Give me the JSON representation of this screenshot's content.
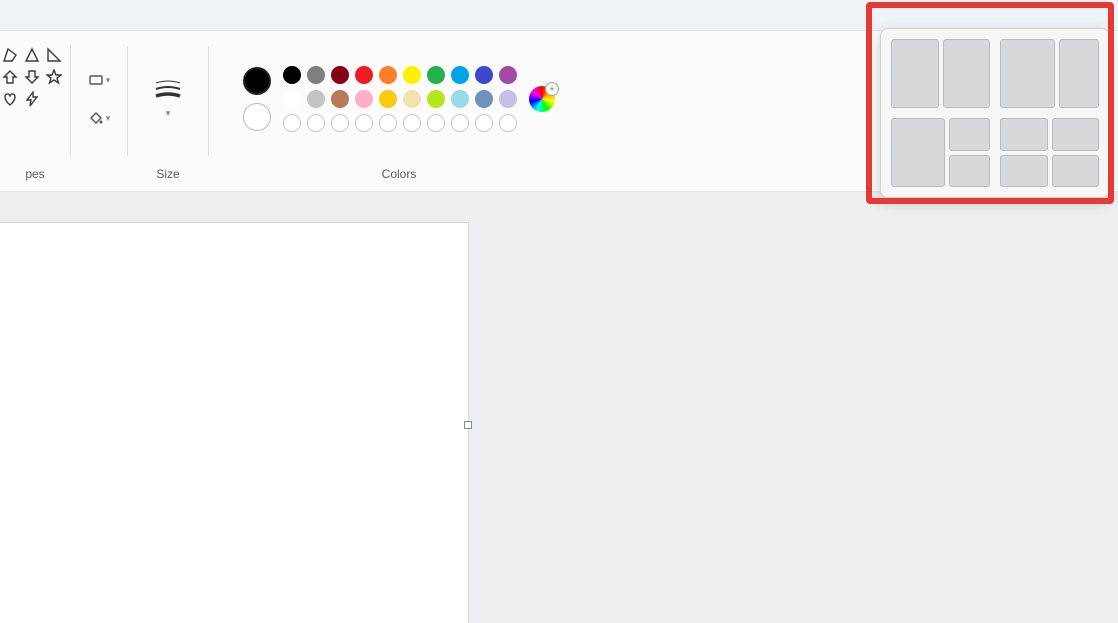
{
  "ribbon": {
    "shapes_label": "pes",
    "size_label": "Size",
    "colors_label": "Colors"
  },
  "colors": {
    "primary": "#000000",
    "secondary": "#ffffff",
    "row1": [
      "#000000",
      "#7f7f7f",
      "#880015",
      "#ed1c24",
      "#ff7f27",
      "#fff200",
      "#22b14c",
      "#00a2e8",
      "#3f48cc",
      "#a349a4"
    ],
    "row2": [
      "#ffffff",
      "#c3c3c3",
      "#b97a57",
      "#ffaec9",
      "#ffc90e",
      "#efe4b0",
      "#b5e61d",
      "#99d9ea",
      "#7092be",
      "#c8bfe7"
    ]
  },
  "snap_layouts": {
    "grid1": [
      [
        1,
        1
      ]
    ],
    "grid2": [
      [
        1,
        1
      ]
    ],
    "grid3": [
      [
        1,
        1,
        1
      ],
      [
        1,
        2,
        3
      ]
    ],
    "grid4": [
      [
        1,
        1
      ],
      [
        2,
        3
      ]
    ]
  }
}
